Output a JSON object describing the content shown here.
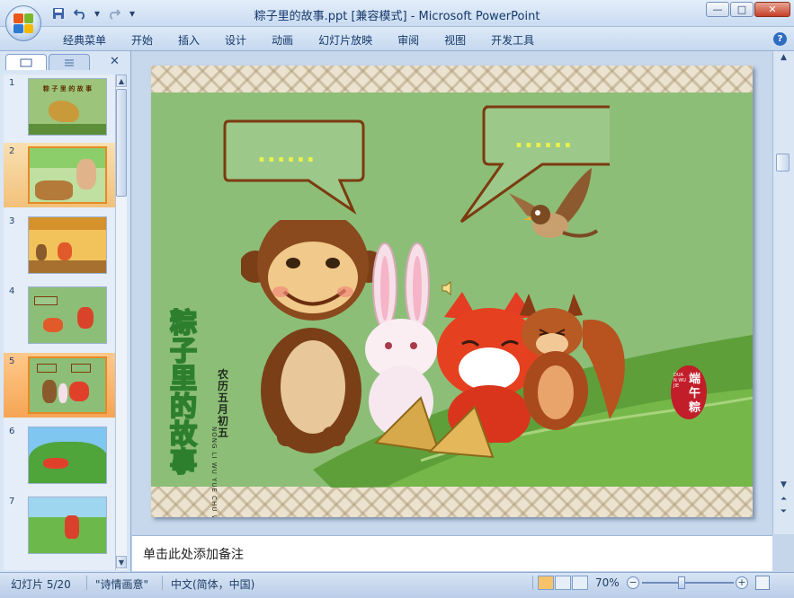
{
  "window": {
    "title": "粽子里的故事.ppt [兼容模式] - Microsoft PowerPoint",
    "controls": {
      "minimize": "—",
      "restore": "□",
      "close": "✕"
    }
  },
  "quick_access": {
    "save_icon": "save-icon",
    "undo_icon": "undo-icon",
    "redo_icon": "redo-icon",
    "customize_icon": "dropdown-arrow-icon"
  },
  "ribbon": {
    "tabs": [
      "经典菜单",
      "开始",
      "插入",
      "设计",
      "动画",
      "幻灯片放映",
      "审阅",
      "视图",
      "开发工具"
    ],
    "help_label": "?"
  },
  "slides_panel": {
    "close_label": "✕",
    "current_slide": 5,
    "hovered_slide": 2,
    "slides": [
      {
        "number": "1",
        "caption": "粽 子 里 的 故 事"
      },
      {
        "number": "2",
        "caption": ""
      },
      {
        "number": "3",
        "caption": ""
      },
      {
        "number": "4",
        "caption": ""
      },
      {
        "number": "5",
        "caption": ""
      },
      {
        "number": "6",
        "caption": ""
      },
      {
        "number": "7",
        "caption": ""
      }
    ]
  },
  "slide": {
    "bubble_left_text": "......",
    "bubble_right_text": "......",
    "vertical_title": [
      "粽",
      "子",
      "里",
      "的",
      "故",
      "事"
    ],
    "date_cn": [
      "农",
      "历",
      "五",
      "月",
      "初",
      "五"
    ],
    "date_pinyin": "NONG LI WU YUE CHU WU",
    "badge_text": [
      "端",
      "午",
      "粽"
    ],
    "badge_pinyin": "DUAN WU JIE",
    "colors": {
      "background": "#8dbe78",
      "bubble_border": "#7b3b0f",
      "dots": "#e8f24a",
      "title_green": "#2d7f2e"
    }
  },
  "notes": {
    "placeholder": "单击此处添加备注"
  },
  "status": {
    "slide_count": "幻灯片 5/20",
    "theme": "\"诗情画意\"",
    "language": "中文(简体，中国)",
    "zoom": "70%",
    "zoom_fraction": 0.43
  }
}
